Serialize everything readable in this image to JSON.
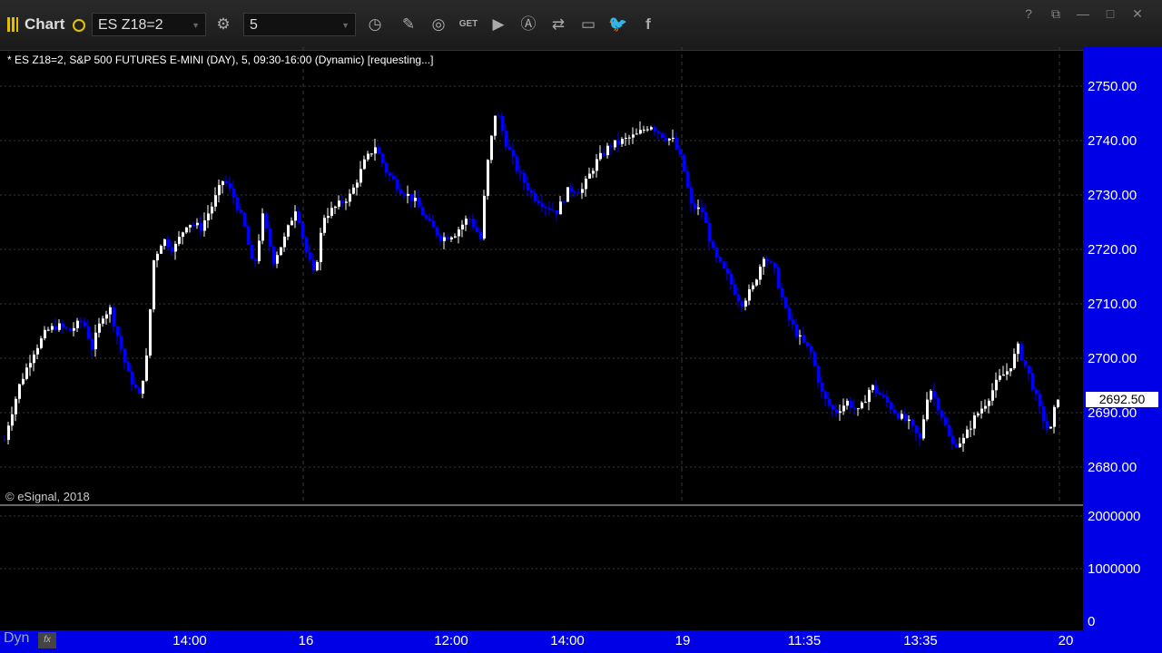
{
  "toolbar": {
    "app_label": "Chart",
    "symbol_value": "ES Z18=2",
    "interval_value": "5",
    "get_label": "GET"
  },
  "header": {
    "label": "* ES Z18=2, S&P 500 FUTURES E-MINI (DAY), 5, 09:30-16:00 (Dynamic) [requesting...]"
  },
  "copyright": "© eSignal, 2018",
  "price_axis": {
    "labels": [
      "2750.00",
      "2740.00",
      "2730.00",
      "2720.00",
      "2710.00",
      "2700.00",
      "2690.00",
      "2680.00"
    ],
    "last_price": "2692.50"
  },
  "volume_axis": {
    "labels": [
      "2000000",
      "1000000",
      "0"
    ]
  },
  "time_axis": {
    "labels": [
      "14:00",
      "16",
      "12:00",
      "14:00",
      "19",
      "11:35",
      "13:35",
      "20"
    ]
  },
  "footer": {
    "dyn_label": "Dyn",
    "fx_label": "fx"
  },
  "colors": {
    "background": "#000000",
    "axis": "#0000e6",
    "up_candle": "#ffffff",
    "down_candle": "#0000ff"
  },
  "chart_data": {
    "type": "candlestick",
    "symbol": "ES Z18=2",
    "interval": "5",
    "ylim": [
      2675,
      2755
    ],
    "close_path": [
      [
        0,
        2682
      ],
      [
        8,
        2688
      ],
      [
        20,
        2695
      ],
      [
        35,
        2701
      ],
      [
        50,
        2705
      ],
      [
        62,
        2706
      ],
      [
        75,
        2705
      ],
      [
        90,
        2707
      ],
      [
        100,
        2702
      ],
      [
        112,
        2708
      ],
      [
        120,
        2709
      ],
      [
        130,
        2703
      ],
      [
        140,
        2697
      ],
      [
        152,
        2693
      ],
      [
        160,
        2700
      ],
      [
        168,
        2718
      ],
      [
        178,
        2722
      ],
      [
        190,
        2720
      ],
      [
        205,
        2725
      ],
      [
        220,
        2724
      ],
      [
        232,
        2728
      ],
      [
        245,
        2733
      ],
      [
        258,
        2729
      ],
      [
        268,
        2724
      ],
      [
        278,
        2716
      ],
      [
        288,
        2726
      ],
      [
        300,
        2718
      ],
      [
        312,
        2722
      ],
      [
        325,
        2728
      ],
      [
        335,
        2720
      ],
      [
        345,
        2715
      ],
      [
        355,
        2726
      ],
      [
        370,
        2728
      ],
      [
        385,
        2730
      ],
      [
        400,
        2736
      ],
      [
        412,
        2739
      ],
      [
        425,
        2734
      ],
      [
        440,
        2731
      ],
      [
        455,
        2729
      ],
      [
        470,
        2725
      ],
      [
        485,
        2722
      ],
      [
        500,
        2723
      ],
      [
        515,
        2726
      ],
      [
        528,
        2722
      ],
      [
        535,
        2735
      ],
      [
        545,
        2746
      ],
      [
        555,
        2740
      ],
      [
        570,
        2734
      ],
      [
        585,
        2730
      ],
      [
        600,
        2728
      ],
      [
        612,
        2727
      ],
      [
        625,
        2731
      ],
      [
        640,
        2731
      ],
      [
        655,
        2736
      ],
      [
        670,
        2739
      ],
      [
        685,
        2740
      ],
      [
        700,
        2741
      ],
      [
        715,
        2743
      ],
      [
        728,
        2741
      ],
      [
        740,
        2740
      ],
      [
        750,
        2736
      ],
      [
        760,
        2728
      ],
      [
        772,
        2727
      ],
      [
        785,
        2719
      ],
      [
        800,
        2715
      ],
      [
        815,
        2710
      ],
      [
        828,
        2713
      ],
      [
        840,
        2719
      ],
      [
        852,
        2716
      ],
      [
        865,
        2708
      ],
      [
        878,
        2704
      ],
      [
        892,
        2701
      ],
      [
        905,
        2693
      ],
      [
        918,
        2690
      ],
      [
        932,
        2692
      ],
      [
        945,
        2690
      ],
      [
        958,
        2695
      ],
      [
        970,
        2693
      ],
      [
        985,
        2690
      ],
      [
        1000,
        2688
      ],
      [
        1012,
        2685
      ],
      [
        1022,
        2695
      ],
      [
        1035,
        2690
      ],
      [
        1047,
        2684
      ],
      [
        1060,
        2685
      ],
      [
        1072,
        2689
      ],
      [
        1085,
        2692
      ],
      [
        1098,
        2696
      ],
      [
        1110,
        2698
      ],
      [
        1120,
        2702
      ],
      [
        1132,
        2697
      ],
      [
        1145,
        2690
      ],
      [
        1155,
        2686
      ],
      [
        1163,
        2693
      ]
    ],
    "volume_axis_range": [
      0,
      2000000
    ],
    "last_price": 2692.5,
    "x_tick_labels": [
      "14:00",
      "16",
      "12:00",
      "14:00",
      "19",
      "11:35",
      "13:35",
      "20"
    ]
  }
}
